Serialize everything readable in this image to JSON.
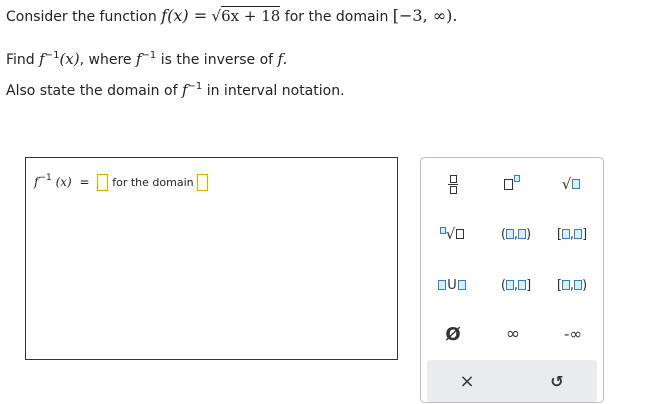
{
  "question": {
    "l1_pre": "Consider the function ",
    "l1_fx": "f(x) =",
    "l1_radicand": "6x + 18",
    "l1_mid": " for the domain ",
    "l1_domain": "[−3, ∞).",
    "l2_pre": "Find ",
    "l2_f": "f",
    "l2_exp": "−1",
    "l2_x": "(x)",
    "l2_mid": ", where ",
    "l2_post": " is the inverse of ",
    "l2_end": "f.",
    "l3_pre": "Also state the domain of ",
    "l3_post": " in interval notation."
  },
  "answer": {
    "f": "f",
    "exp": "−1",
    "x": "(x)",
    "eq": "=",
    "for_domain": "for the domain"
  },
  "palette": {
    "open_paren": "(",
    "close_paren": ")",
    "open_bracket": "[",
    "close_bracket": "]",
    "comma": ",",
    "union": "U",
    "empty_set": "Ø",
    "infinity": "∞",
    "neg_infinity": "-∞",
    "clear": "×",
    "undo": "↺"
  },
  "colors": {
    "accent_blue": "#2f7fc9",
    "slot_border": "#e0a800",
    "panel_border": "#b9bcc2",
    "bar_bg": "#e9ebee"
  }
}
